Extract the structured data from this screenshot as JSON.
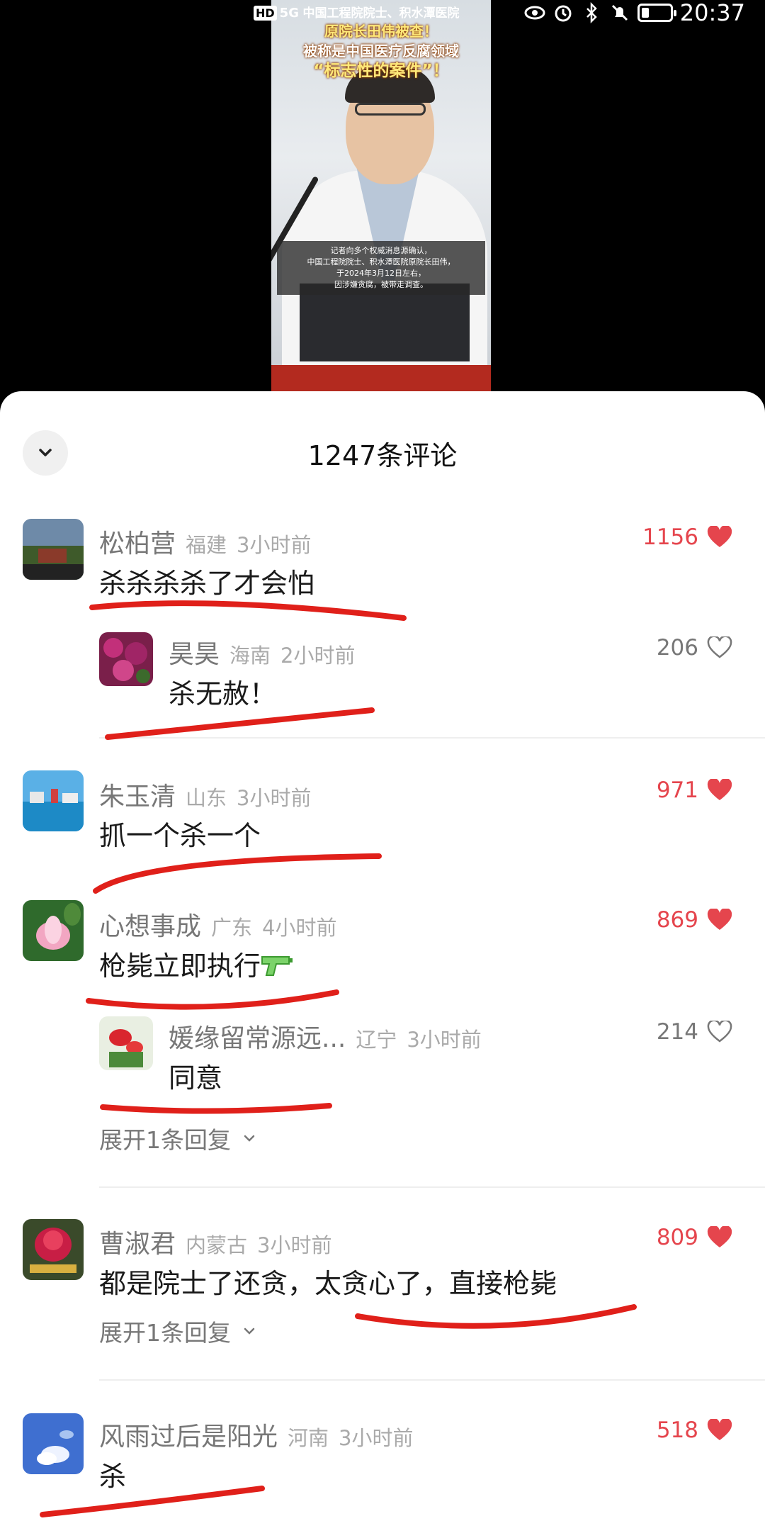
{
  "status_bar": {
    "hd": "HD",
    "network": "5G",
    "time": "20:37"
  },
  "video": {
    "headline_overlay": "中国工程院院士、积水潭医院",
    "headline_line2": "原院长田伟被查！",
    "headline_line3": "被称是中国医疗反腐领域",
    "headline_line4": "“标志性的案件”！",
    "caption_line1": "记者向多个权威消息源确认，",
    "caption_line2": "中国工程院院士、积水潭医院原院长田伟，",
    "caption_line3": "于2024年3月12日左右，",
    "caption_line4": "因涉嫌贪腐，被带走调查。"
  },
  "sheet": {
    "title": "1247条评论"
  },
  "comments": [
    {
      "user": "松柏营",
      "region": "福建",
      "time": "3小时前",
      "text": "杀杀杀杀了才会怕",
      "likes": "1156",
      "liked": true
    },
    {
      "user": "昊昊",
      "region": "海南",
      "time": "2小时前",
      "text": "杀无赦！",
      "likes": "206",
      "liked": false
    },
    {
      "user": "朱玉清",
      "region": "山东",
      "time": "3小时前",
      "text": "抓一个杀一个",
      "likes": "971",
      "liked": true
    },
    {
      "user": "心想事成",
      "region": "广东",
      "time": "4小时前",
      "text": "枪毙立即执行",
      "likes": "869",
      "liked": true
    },
    {
      "user": "媛缘留常源远...",
      "region": "辽宁",
      "time": "3小时前",
      "text": "同意",
      "likes": "214",
      "liked": false
    },
    {
      "user": "曹淑君",
      "region": "内蒙古",
      "time": "3小时前",
      "text": "都是院士了还贪，太贪心了，直接枪毙",
      "likes": "809",
      "liked": true
    },
    {
      "user": "风雨过后是阳光",
      "region": "河南",
      "time": "3小时前",
      "text": "杀",
      "likes": "518",
      "liked": true
    }
  ],
  "expand_replies": [
    {
      "label": "展开1条回复"
    },
    {
      "label": "展开1条回复"
    }
  ],
  "colors": {
    "like_red": "#e5454d",
    "ink_red": "#e0201a"
  },
  "icons": {
    "collapse": "chevron-down-icon",
    "like_filled": "heart-filled-icon",
    "like_outline": "heart-outline-icon",
    "expand": "chevron-down-icon",
    "emoji": "water-pistol-emoji"
  }
}
